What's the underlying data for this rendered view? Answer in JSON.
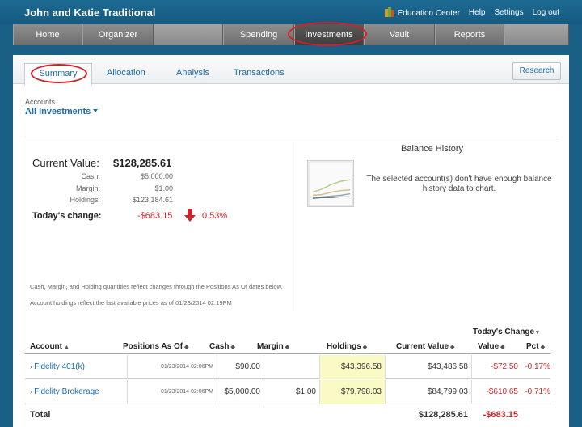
{
  "header": {
    "title": "John and Katie Traditional",
    "links": [
      "Education Center",
      "Help",
      "Settings",
      "Log out"
    ]
  },
  "main_nav": [
    "Home",
    "Organizer",
    "",
    "Spending",
    "Investments",
    "Vault",
    "Reports",
    ""
  ],
  "sub_nav": {
    "tabs": [
      "Summary",
      "Allocation",
      "Analysis",
      "Transactions"
    ],
    "research_label": "Research"
  },
  "accounts": {
    "label": "Accounts",
    "selected": "All Investments"
  },
  "summary": {
    "current_value_label": "Current Value:",
    "current_value": "$128,285.61",
    "breakdown": [
      {
        "label": "Cash:",
        "value": "$5,000.00"
      },
      {
        "label": "Margin:",
        "value": "$1.00"
      },
      {
        "label": "Holdings:",
        "value": "$123,184.61"
      }
    ],
    "todays_change_label": "Today's change:",
    "todays_change_value": "-$683.15",
    "todays_change_pct": "0.53%",
    "footnotes": [
      "Cash, Margin, and Holding quantities reflect changes through the Positions As Of dates below.",
      "Account holdings reflect the last available prices as of 01/23/2014 02:19PM"
    ]
  },
  "balance_history": {
    "title": "Balance History",
    "message": "The selected account(s) don't have enough balance history data to chart."
  },
  "table": {
    "group_header": "Today's Change",
    "columns": [
      "Account",
      "Positions As Of",
      "Cash",
      "Margin",
      "Holdings",
      "Current Value",
      "Value",
      "Pct"
    ],
    "rows": [
      {
        "account": "Fidelity 401(k)",
        "positions_as_of": "01/23/2014 02:06PM",
        "cash": "$90.00",
        "margin": "",
        "holdings": "$43,396.58",
        "current_value": "$43,486.58",
        "value": "-$72.50",
        "pct": "-0.17%"
      },
      {
        "account": "Fidelity Brokerage",
        "positions_as_of": "01/23/2014 02:06PM",
        "cash": "$5,000.00",
        "margin": "$1.00",
        "holdings": "$79,798.03",
        "current_value": "$84,799.03",
        "value": "-$610.65",
        "pct": "-0.71%"
      }
    ],
    "total_label": "Total",
    "total_current_value": "$128,285.61",
    "total_value": "-$683.15"
  },
  "colors": {
    "link": "#1c6aa8",
    "negative": "#c6262d",
    "highlight_oval": "#d0202a",
    "holdings_bg": "#fafac6"
  }
}
